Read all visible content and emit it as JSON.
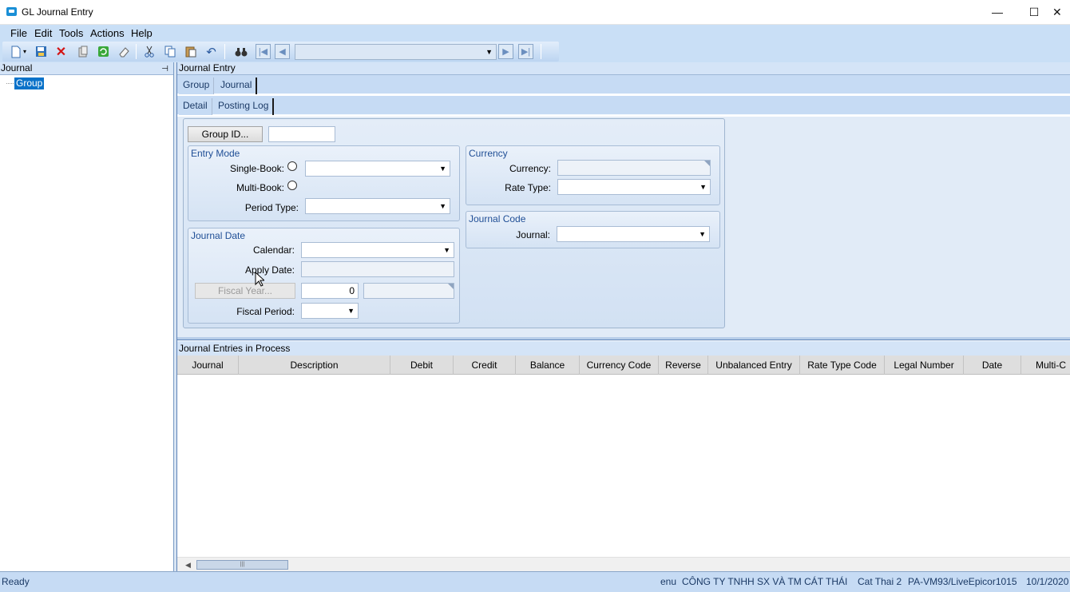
{
  "window": {
    "title": "GL Journal Entry",
    "minimize": "—",
    "maximize": "☐",
    "close": "✕"
  },
  "menu": [
    "File",
    "Edit",
    "Tools",
    "Actions",
    "Help"
  ],
  "toolbar": {
    "nav_combo_value": ""
  },
  "left_panel": {
    "header": "Journal",
    "tree_item": "Group"
  },
  "right_panel": {
    "header": "Journal Entry",
    "tabs_top": [
      "Group",
      "Journal"
    ],
    "tabs_sub": [
      "Detail",
      "Posting Log"
    ]
  },
  "form": {
    "group_id_button": "Group ID...",
    "group_id_value": "",
    "entry_mode": {
      "title": "Entry Mode",
      "single_book_label": "Single-Book:",
      "multi_book_label": "Multi-Book:",
      "period_type_label": "Period Type:"
    },
    "journal_date": {
      "title": "Journal Date",
      "calendar_label": "Calendar:",
      "apply_date_label": "Apply Date:",
      "fiscal_year_button": "Fiscal Year...",
      "fiscal_year_value": "0",
      "fiscal_period_label": "Fiscal Period:"
    },
    "currency": {
      "title": "Currency",
      "currency_label": "Currency:",
      "rate_type_label": "Rate Type:"
    },
    "journal_code": {
      "title": "Journal Code",
      "journal_label": "Journal:"
    }
  },
  "grid": {
    "title": "Journal Entries in Process",
    "columns": [
      "Journal",
      "Description",
      "Debit",
      "Credit",
      "Balance",
      "Currency Code",
      "Reverse",
      "Unbalanced Entry",
      "Rate Type Code",
      "Legal Number",
      "Date",
      "Multi-C"
    ]
  },
  "status": {
    "ready": "Ready",
    "lang": "enu",
    "company": "CÔNG TY TNHH SX VÀ TM CÁT THÁI",
    "site": "Cat Thai 2",
    "server": "PA-VM93/LiveEpicor1015",
    "date": "10/1/2020"
  },
  "colors": {
    "accent": "#0a72c9",
    "panel_bg": "#c6dbf4",
    "group_title": "#1f4e96"
  }
}
